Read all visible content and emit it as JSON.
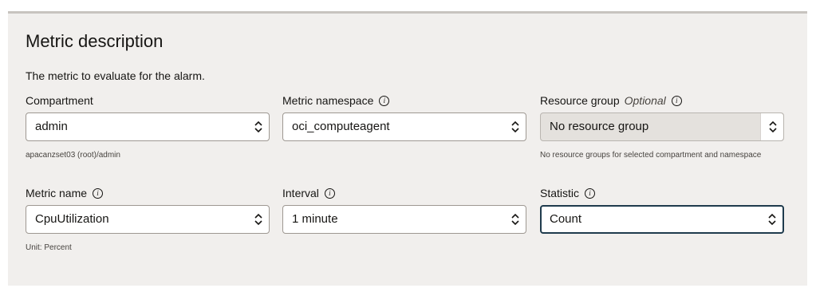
{
  "section": {
    "title": "Metric description",
    "description": "The metric to evaluate for the alarm."
  },
  "fields": {
    "compartment": {
      "label": "Compartment",
      "value": "admin",
      "hint": "apacanzset03 (root)/admin"
    },
    "metric_namespace": {
      "label": "Metric namespace",
      "value": "oci_computeagent"
    },
    "resource_group": {
      "label": "Resource group",
      "optional": "Optional",
      "value": "No resource group",
      "hint": "No resource groups for selected compartment and namespace"
    },
    "metric_name": {
      "label": "Metric name",
      "value": "CpuUtilization",
      "hint": "Unit: Percent"
    },
    "interval": {
      "label": "Interval",
      "value": "1 minute"
    },
    "statistic": {
      "label": "Statistic",
      "value": "Count"
    }
  },
  "icons": {
    "info": "info-icon",
    "chevron": "up-down-chevron-icon"
  },
  "colors": {
    "panel_bg": "#f1efed",
    "focus_border": "#1f3b4d",
    "input_border": "#9e9892"
  }
}
